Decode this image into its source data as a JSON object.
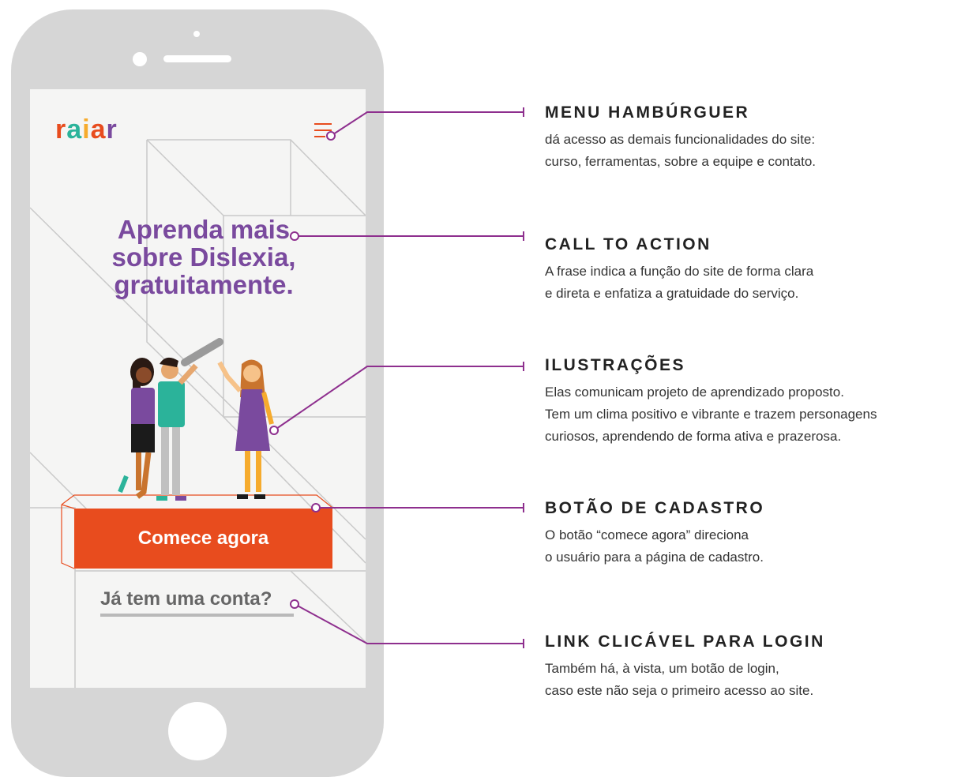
{
  "colors": {
    "accent_orange": "#e84c1e",
    "purple": "#7a4a9e",
    "annotation_line": "#8e2f8e",
    "logo_teal": "#2bb39a",
    "logo_yellow": "#f6ab2d"
  },
  "app": {
    "logo": "raiar",
    "menu_icon": "hamburger-menu-icon",
    "headline": [
      "Aprenda mais",
      "sobre Dislexia,",
      "gratuitamente."
    ],
    "cta_label": "Comece agora",
    "login_label": "Já tem uma conta?"
  },
  "annotations": [
    {
      "title": "MENU HAMBÚRGUER",
      "lines": [
        "dá acesso as demais funcionalidades do site:",
        "curso, ferramentas, sobre a equipe e contato."
      ]
    },
    {
      "title": "CALL TO ACTION",
      "lines": [
        "A frase indica a função do site de forma clara",
        "e direta e enfatiza a gratuidade do serviço."
      ]
    },
    {
      "title": "ILUSTRAÇÕES",
      "lines": [
        "Elas comunicam projeto de aprendizado proposto.",
        "Tem um clima positivo e vibrante e trazem personagens",
        "curiosos, aprendendo de forma ativa e prazerosa."
      ]
    },
    {
      "title": "BOTÃO DE CADASTRO",
      "lines": [
        "O botão “comece agora” direciona",
        "o usuário para a página de cadastro."
      ]
    },
    {
      "title": "LINK CLICÁVEL PARA LOGIN",
      "lines": [
        "Também há, à vista, um botão de login,",
        "caso este não seja o primeiro acesso ao site."
      ]
    }
  ]
}
